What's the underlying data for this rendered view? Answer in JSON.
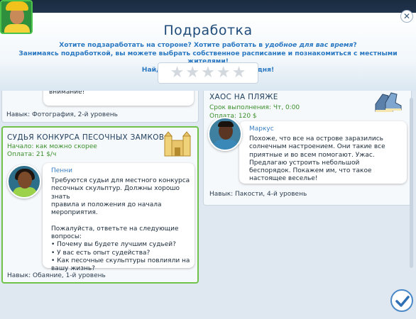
{
  "header": {
    "title": "Подработка",
    "line1_a": "Хотите подзаработать на стороне? Хотите работать в ",
    "line1_em": "удобное для вас время",
    "line1_b": "?",
    "line2": "Занимаясь подработкой, вы можете выбрать собственное расписание и познакомиться с местными жителями!",
    "line3": "Найдите подработку уже сегодня!",
    "rating_stars": 0
  },
  "cards": {
    "top_left": {
      "partial_text": "внимание!",
      "skill": "Навык: Фотография, 2-й уровень"
    },
    "sandcastle": {
      "title": "СУДЬЯ КОНКУРСА ПЕСОЧНЫХ ЗАМКОВ",
      "start": "Начало: как можно скорее",
      "pay": "Оплата: 21 $/ч",
      "sim_name": "Пенни",
      "text": "Требуются судьи для местного конкурса\nпесочных скульптур. Должны хорошо знать\nправила и положения до начала\nмероприятия.\n\nПожалуйста, ответьте на следующие\nвопросы:\n• Почему вы будете лучшим судьей?\n• У вас есть опыт судейства?\n• Как песочные скульптуры повлияли на\nвашу жизнь?",
      "skill": "Навык: Обаяние, 1-й уровень"
    },
    "beach_chaos": {
      "title": "ХАОС НА ПЛЯЖЕ",
      "deadline": "Срок выполнения: Чт, 0:00",
      "pay": "Оплата: 120 $",
      "sim_name": "Маркус",
      "text": "Похоже, что все на острове заразились\nсолнечным настроением. Они такие все\nприятные и во всем помогают. Ужас.\nПредлагаю устроить небольшой\nбеспорядок. Покажем им, что такое\nнастоящее веселье!",
      "skill": "Навык: Пакости, 4-й уровень"
    }
  },
  "colors": {
    "selected_border": "#6fc24a",
    "title_blue": "#1f4b7a",
    "pay_green": "#3a8f2a"
  }
}
